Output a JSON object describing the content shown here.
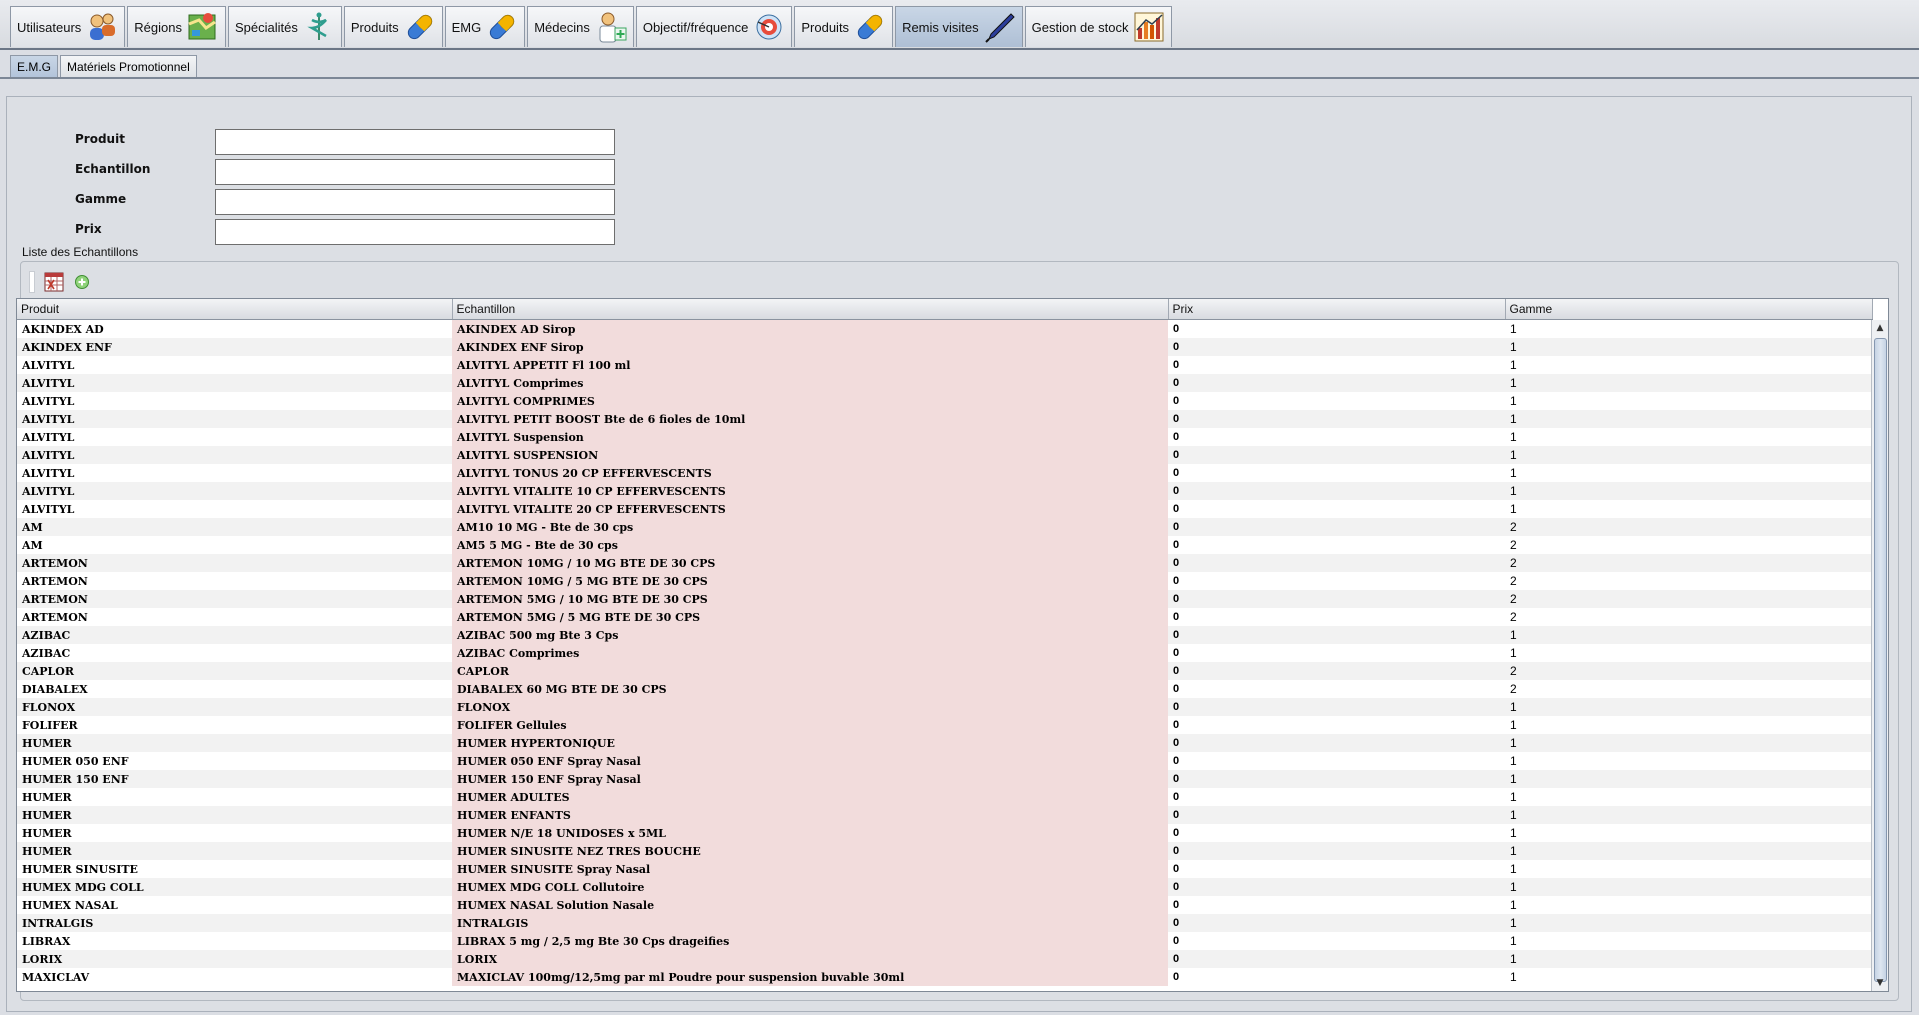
{
  "tabs": [
    {
      "label": "Utilisateurs",
      "icon": "users-icon"
    },
    {
      "label": "Régions",
      "icon": "map-icon"
    },
    {
      "label": "Spécialités",
      "icon": "caduceus-icon"
    },
    {
      "label": "Produits",
      "icon": "capsule-icon"
    },
    {
      "label": "EMG",
      "icon": "capsule-icon"
    },
    {
      "label": "Médecins",
      "icon": "doctor-icon"
    },
    {
      "label": "Objectif/fréquence",
      "icon": "target-icon"
    },
    {
      "label": "Produits",
      "icon": "capsule-icon"
    },
    {
      "label": "Remis visites",
      "icon": "pen-icon",
      "active": true
    },
    {
      "label": "Gestion de stock",
      "icon": "stock-chart-icon"
    }
  ],
  "subtabs": [
    {
      "label": "E.M.G",
      "active": true
    },
    {
      "label": "Matériels Promotionnel"
    }
  ],
  "form": {
    "produit_label": "Produit",
    "produit_value": "",
    "echantillon_label": "Echantillon",
    "echantillon_value": "",
    "gamme_label": "Gamme",
    "gamme_value": "",
    "prix_label": "Prix",
    "prix_value": ""
  },
  "list": {
    "title": "Liste des Echantillons",
    "toolbar_icons": [
      "export-excel-icon",
      "add-icon"
    ],
    "columns": [
      "Produit",
      "Echantillon",
      "Prix",
      "Gamme"
    ],
    "rows": [
      [
        "AKINDEX AD",
        "AKINDEX AD Sirop",
        "0",
        "1"
      ],
      [
        "AKINDEX ENF",
        "AKINDEX ENF Sirop",
        "0",
        "1"
      ],
      [
        "ALVITYL",
        "ALVITYL APPETIT Fl 100 ml",
        "0",
        "1"
      ],
      [
        "ALVITYL",
        "ALVITYL Comprimes",
        "0",
        "1"
      ],
      [
        "ALVITYL",
        "ALVITYL COMPRIMES",
        "0",
        "1"
      ],
      [
        "ALVITYL",
        "ALVITYL PETIT BOOST Bte de 6 fioles de 10ml",
        "0",
        "1"
      ],
      [
        "ALVITYL",
        "ALVITYL Suspension",
        "0",
        "1"
      ],
      [
        "ALVITYL",
        "ALVITYL SUSPENSION",
        "0",
        "1"
      ],
      [
        "ALVITYL",
        "ALVITYL TONUS 20 CP EFFERVESCENTS",
        "0",
        "1"
      ],
      [
        "ALVITYL",
        "ALVITYL VITALITE 10 CP EFFERVESCENTS",
        "0",
        "1"
      ],
      [
        "ALVITYL",
        "ALVITYL VITALITE 20 CP EFFERVESCENTS",
        "0",
        "1"
      ],
      [
        "AM",
        "AM10 10 MG - Bte de 30 cps",
        "0",
        "2"
      ],
      [
        "AM",
        "AM5 5 MG  - Bte de 30 cps",
        "0",
        "2"
      ],
      [
        "ARTEMON",
        "ARTEMON 10MG / 10 MG BTE DE 30 CPS",
        "0",
        "2"
      ],
      [
        "ARTEMON",
        "ARTEMON 10MG / 5 MG BTE DE 30 CPS",
        "0",
        "2"
      ],
      [
        "ARTEMON",
        "ARTEMON 5MG / 10 MG BTE DE 30 CPS",
        "0",
        "2"
      ],
      [
        "ARTEMON",
        "ARTEMON 5MG / 5 MG BTE DE 30 CPS",
        "0",
        "2"
      ],
      [
        "AZIBAC",
        "AZIBAC 500 mg Bte 3 Cps",
        "0",
        "1"
      ],
      [
        "AZIBAC",
        "AZIBAC Comprimes",
        "0",
        "1"
      ],
      [
        "CAPLOR",
        "CAPLOR",
        "0",
        "2"
      ],
      [
        "DIABALEX",
        "DIABALEX 60 MG BTE DE 30 CPS",
        "0",
        "2"
      ],
      [
        "FLONOX",
        "FLONOX",
        "0",
        "1"
      ],
      [
        "FOLIFER",
        "FOLIFER Gellules",
        "0",
        "1"
      ],
      [
        "HUMER",
        "HUMER  HYPERTONIQUE",
        "0",
        "1"
      ],
      [
        "HUMER 050 ENF",
        "HUMER 050 ENF Spray Nasal",
        "0",
        "1"
      ],
      [
        "HUMER 150 ENF",
        "HUMER 150 ENF Spray Nasal",
        "0",
        "1"
      ],
      [
        "HUMER",
        "HUMER ADULTES",
        "0",
        "1"
      ],
      [
        "HUMER",
        "HUMER ENFANTS",
        "0",
        "1"
      ],
      [
        "HUMER",
        "HUMER N/E 18 UNIDOSES x 5ML",
        "0",
        "1"
      ],
      [
        "HUMER",
        "HUMER SINUSITE NEZ TRES BOUCHE",
        "0",
        "1"
      ],
      [
        "HUMER SINUSITE",
        "HUMER SINUSITE Spray Nasal",
        "0",
        "1"
      ],
      [
        "HUMEX MDG COLL",
        "HUMEX MDG COLL Collutoire",
        "0",
        "1"
      ],
      [
        "HUMEX NASAL",
        "HUMEX NASAL Solution Nasale",
        "0",
        "1"
      ],
      [
        "INTRALGIS",
        "INTRALGIS",
        "0",
        "1"
      ],
      [
        "LIBRAX",
        "LIBRAX  5 mg / 2,5 mg Bte 30 Cps drageifies",
        "0",
        "1"
      ],
      [
        "LORIX",
        "LORIX",
        "0",
        "1"
      ],
      [
        "MAXICLAV",
        "MAXICLAV 100mg/12,5mg par ml Poudre pour suspension buvable 30ml",
        "0",
        "1"
      ]
    ]
  }
}
